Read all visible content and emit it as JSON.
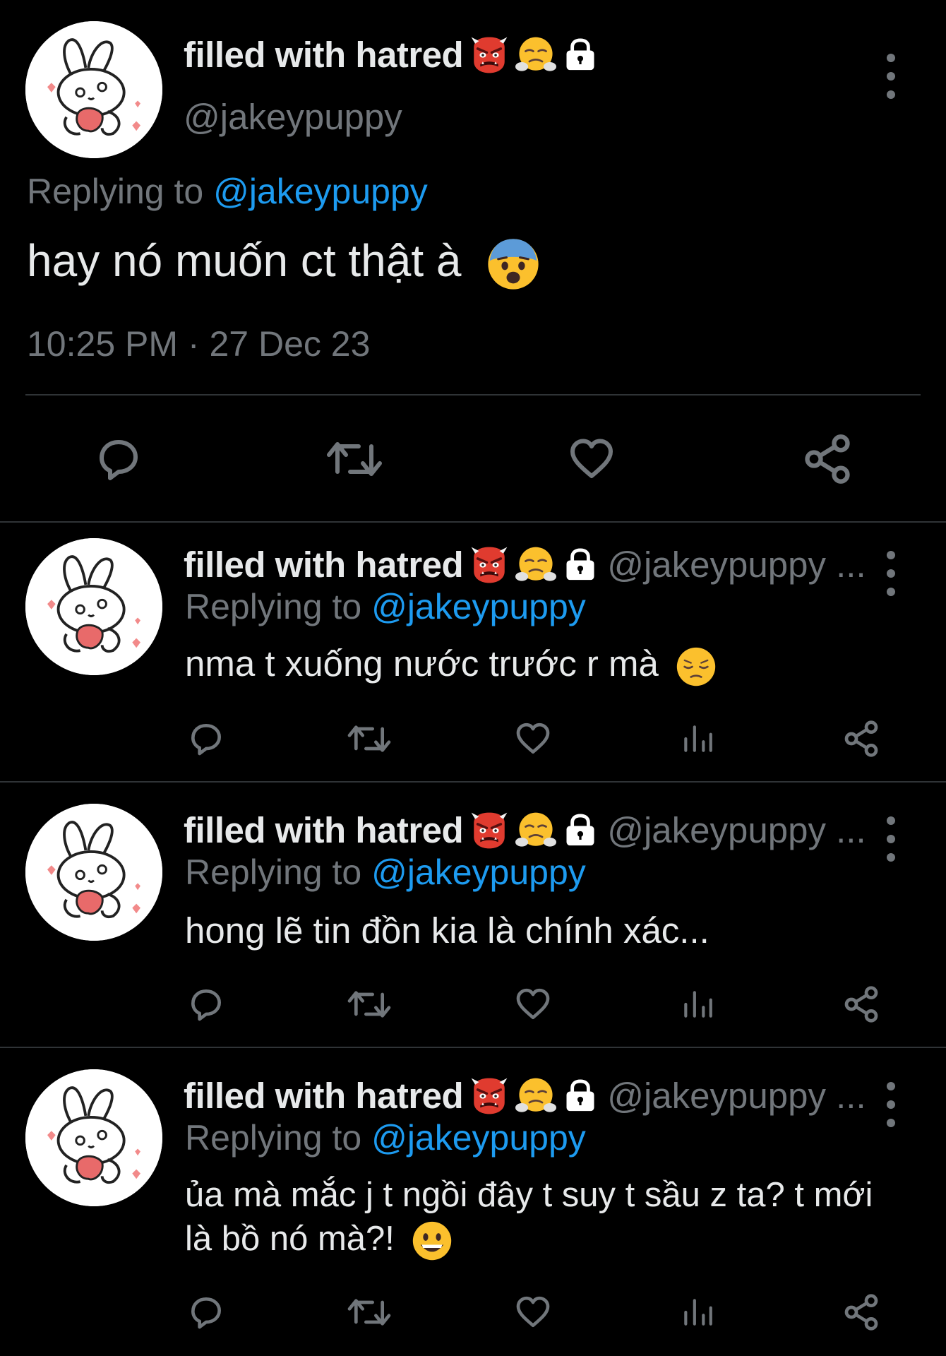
{
  "main_tweet": {
    "display_name": "filled with hatred",
    "handle": "@jakeypuppy",
    "replying_prefix": "Replying to",
    "replying_to": "@jakeypuppy",
    "text": "hay nó muốn ct thật à",
    "timestamp": "10:25 PM · 27 Dec 23"
  },
  "replies": [
    {
      "display_name": "filled with hatred",
      "handle": "@jakeypuppy ...",
      "replying_prefix": "Replying to",
      "replying_to": "@jakeypuppy",
      "text": "nma t xuống nước trước r mà"
    },
    {
      "display_name": "filled with hatred",
      "handle": "@jakeypuppy ...",
      "replying_prefix": "Replying to",
      "replying_to": "@jakeypuppy",
      "text": "hong lẽ tin đồn kia là chính xác..."
    },
    {
      "display_name": "filled with hatred",
      "handle": "@jakeypuppy ...",
      "replying_prefix": "Replying to",
      "replying_to": "@jakeypuppy",
      "text_line1": "ủa mà mắc j t ngồi đây t suy t sầu z ta? t mới",
      "text_line2": "là bồ nó mà?!"
    }
  ],
  "icons": {
    "reply": "reply-icon",
    "retweet": "retweet-icon",
    "like": "heart-icon",
    "views": "views-icon",
    "share": "share-icon",
    "more": "more-options-icon",
    "lock": "lock-icon",
    "name_emojis": [
      "ogre-emoji",
      "steam-face-emoji"
    ],
    "body_emojis": [
      "fearful-face-emoji",
      "pensive-face-emoji",
      "grinning-face-emoji"
    ]
  },
  "colors": {
    "background": "#000000",
    "text": "#e7e9ea",
    "muted": "#71767b",
    "mention": "#1d9bf0",
    "divider": "#2f3336"
  }
}
